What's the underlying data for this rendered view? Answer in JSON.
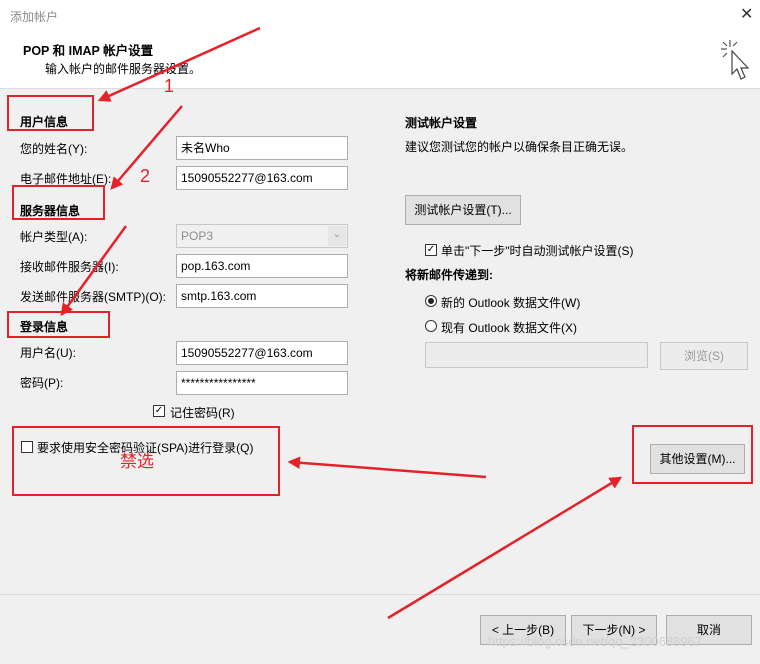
{
  "window": {
    "title": "添加帐户"
  },
  "header": {
    "title": "POP 和 IMAP 帐户设置",
    "subtitle": "输入帐户的邮件服务器设置。"
  },
  "user_info": {
    "section": "用户信息",
    "name_label": "您的姓名(Y):",
    "name_value": "未名Who",
    "email_label": "电子邮件地址(E):",
    "email_value": "15090552277@163.com"
  },
  "server_info": {
    "section": "服务器信息",
    "type_label": "帐户类型(A):",
    "type_value": "POP3",
    "incoming_label": "接收邮件服务器(I):",
    "incoming_value": "pop.163.com",
    "outgoing_label": "发送邮件服务器(SMTP)(O):",
    "outgoing_value": "smtp.163.com"
  },
  "login_info": {
    "section": "登录信息",
    "user_label": "用户名(U):",
    "user_value": "15090552277@163.com",
    "password_label": "密码(P):",
    "password_value": "****************",
    "remember_label": "记住密码(R)",
    "remember_checked": true,
    "spa_label": "要求使用安全密码验证(SPA)进行登录(Q)",
    "spa_checked": false
  },
  "test": {
    "section": "测试帐户设置",
    "desc": "建议您测试您的帐户以确保条目正确无误。",
    "button": "测试帐户设置(T)...",
    "auto_label": "单击\"下一步\"时自动测试帐户设置(S)",
    "auto_checked": true
  },
  "deliver": {
    "section": "将新邮件传递到:",
    "option_new": "新的 Outlook 数据文件(W)",
    "option_existing": "现有 Outlook 数据文件(X)",
    "path_value": "",
    "browse": "浏览(S)"
  },
  "more_settings": "其他设置(M)...",
  "footer": {
    "back": "< 上一步(B)",
    "next": "下一步(N) >",
    "cancel": "取消"
  },
  "annotations": {
    "num1": "1",
    "num2": "2",
    "note": "禁选"
  },
  "watermark": "https://blog.csdn.net/qq_2300688967",
  "colors": {
    "annotation": "#e5222a",
    "content_bg": "#f0f0f0"
  }
}
